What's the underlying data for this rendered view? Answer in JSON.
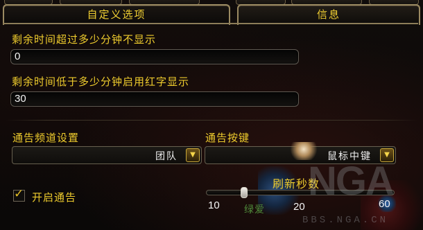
{
  "tabs": [
    {
      "label": "自定义选项",
      "active": true
    },
    {
      "label": "信息",
      "active": false
    }
  ],
  "settings": {
    "hide_over_label": "剩余时间超过多少分钟不显示",
    "hide_over_value": "0",
    "red_below_label": "剩余时间低于多少分钟启用红字显示",
    "red_below_value": "30"
  },
  "announce": {
    "channel_label": "通告频道设置",
    "channel_value": "团队",
    "key_label": "通告按键",
    "key_value": "鼠标中键",
    "enable_label": "开启通告",
    "enable_checked": true
  },
  "refresh": {
    "label": "刷新秒数",
    "min_label": "10",
    "max_label": "60",
    "value_label": "20",
    "value": 20,
    "min": 10,
    "max": 60
  },
  "background": {
    "status_text": "绿爱",
    "watermark_logo": "NGA",
    "watermark_url": "BBS.NGA.CN"
  },
  "colors": {
    "label_gold": "#efcc2d",
    "border_gold": "#9b8a62",
    "text_white": "#f4f4f4"
  },
  "icons": {
    "dropdown_arrow": "chevron-down-icon",
    "checkbox_mark": "checkmark-icon"
  }
}
